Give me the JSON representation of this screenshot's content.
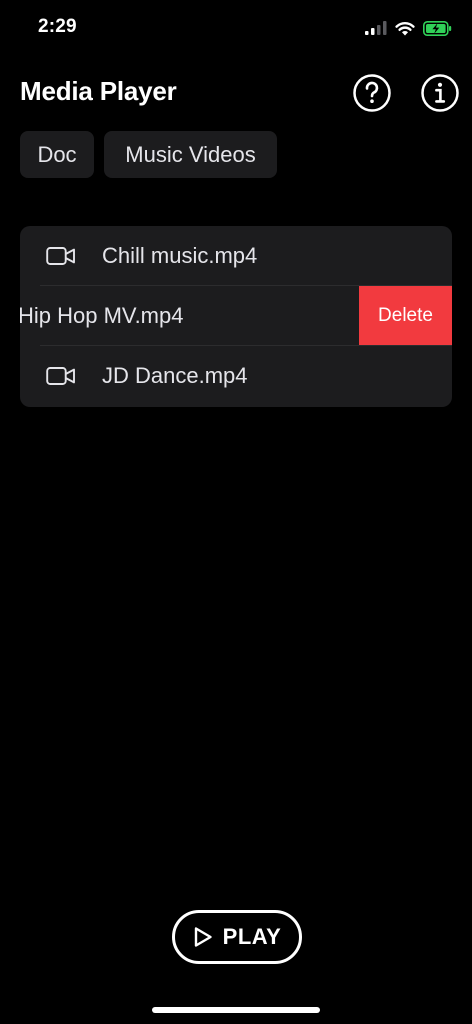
{
  "status_bar": {
    "time": "2:29",
    "icons": [
      "cellular-signal-icon",
      "wifi-icon",
      "battery-charging-icon"
    ],
    "battery_color": "#30d158"
  },
  "header": {
    "title": "Media Player",
    "help_icon": "question-circle-icon",
    "info_icon": "info-circle-icon"
  },
  "tabs": [
    {
      "label": "Doc"
    },
    {
      "label": "Music Videos"
    }
  ],
  "files": [
    {
      "name": "Chill music.mp4",
      "icon": "video-camera-icon"
    },
    {
      "name": "Hip Hop MV.mp4",
      "icon": "video-camera-icon",
      "swiped": true
    },
    {
      "name": "JD Dance.mp4",
      "icon": "video-camera-icon"
    }
  ],
  "swipe_action": {
    "label": "Delete",
    "color": "#f23a3f"
  },
  "play_button": {
    "label": "PLAY",
    "icon": "play-icon"
  }
}
